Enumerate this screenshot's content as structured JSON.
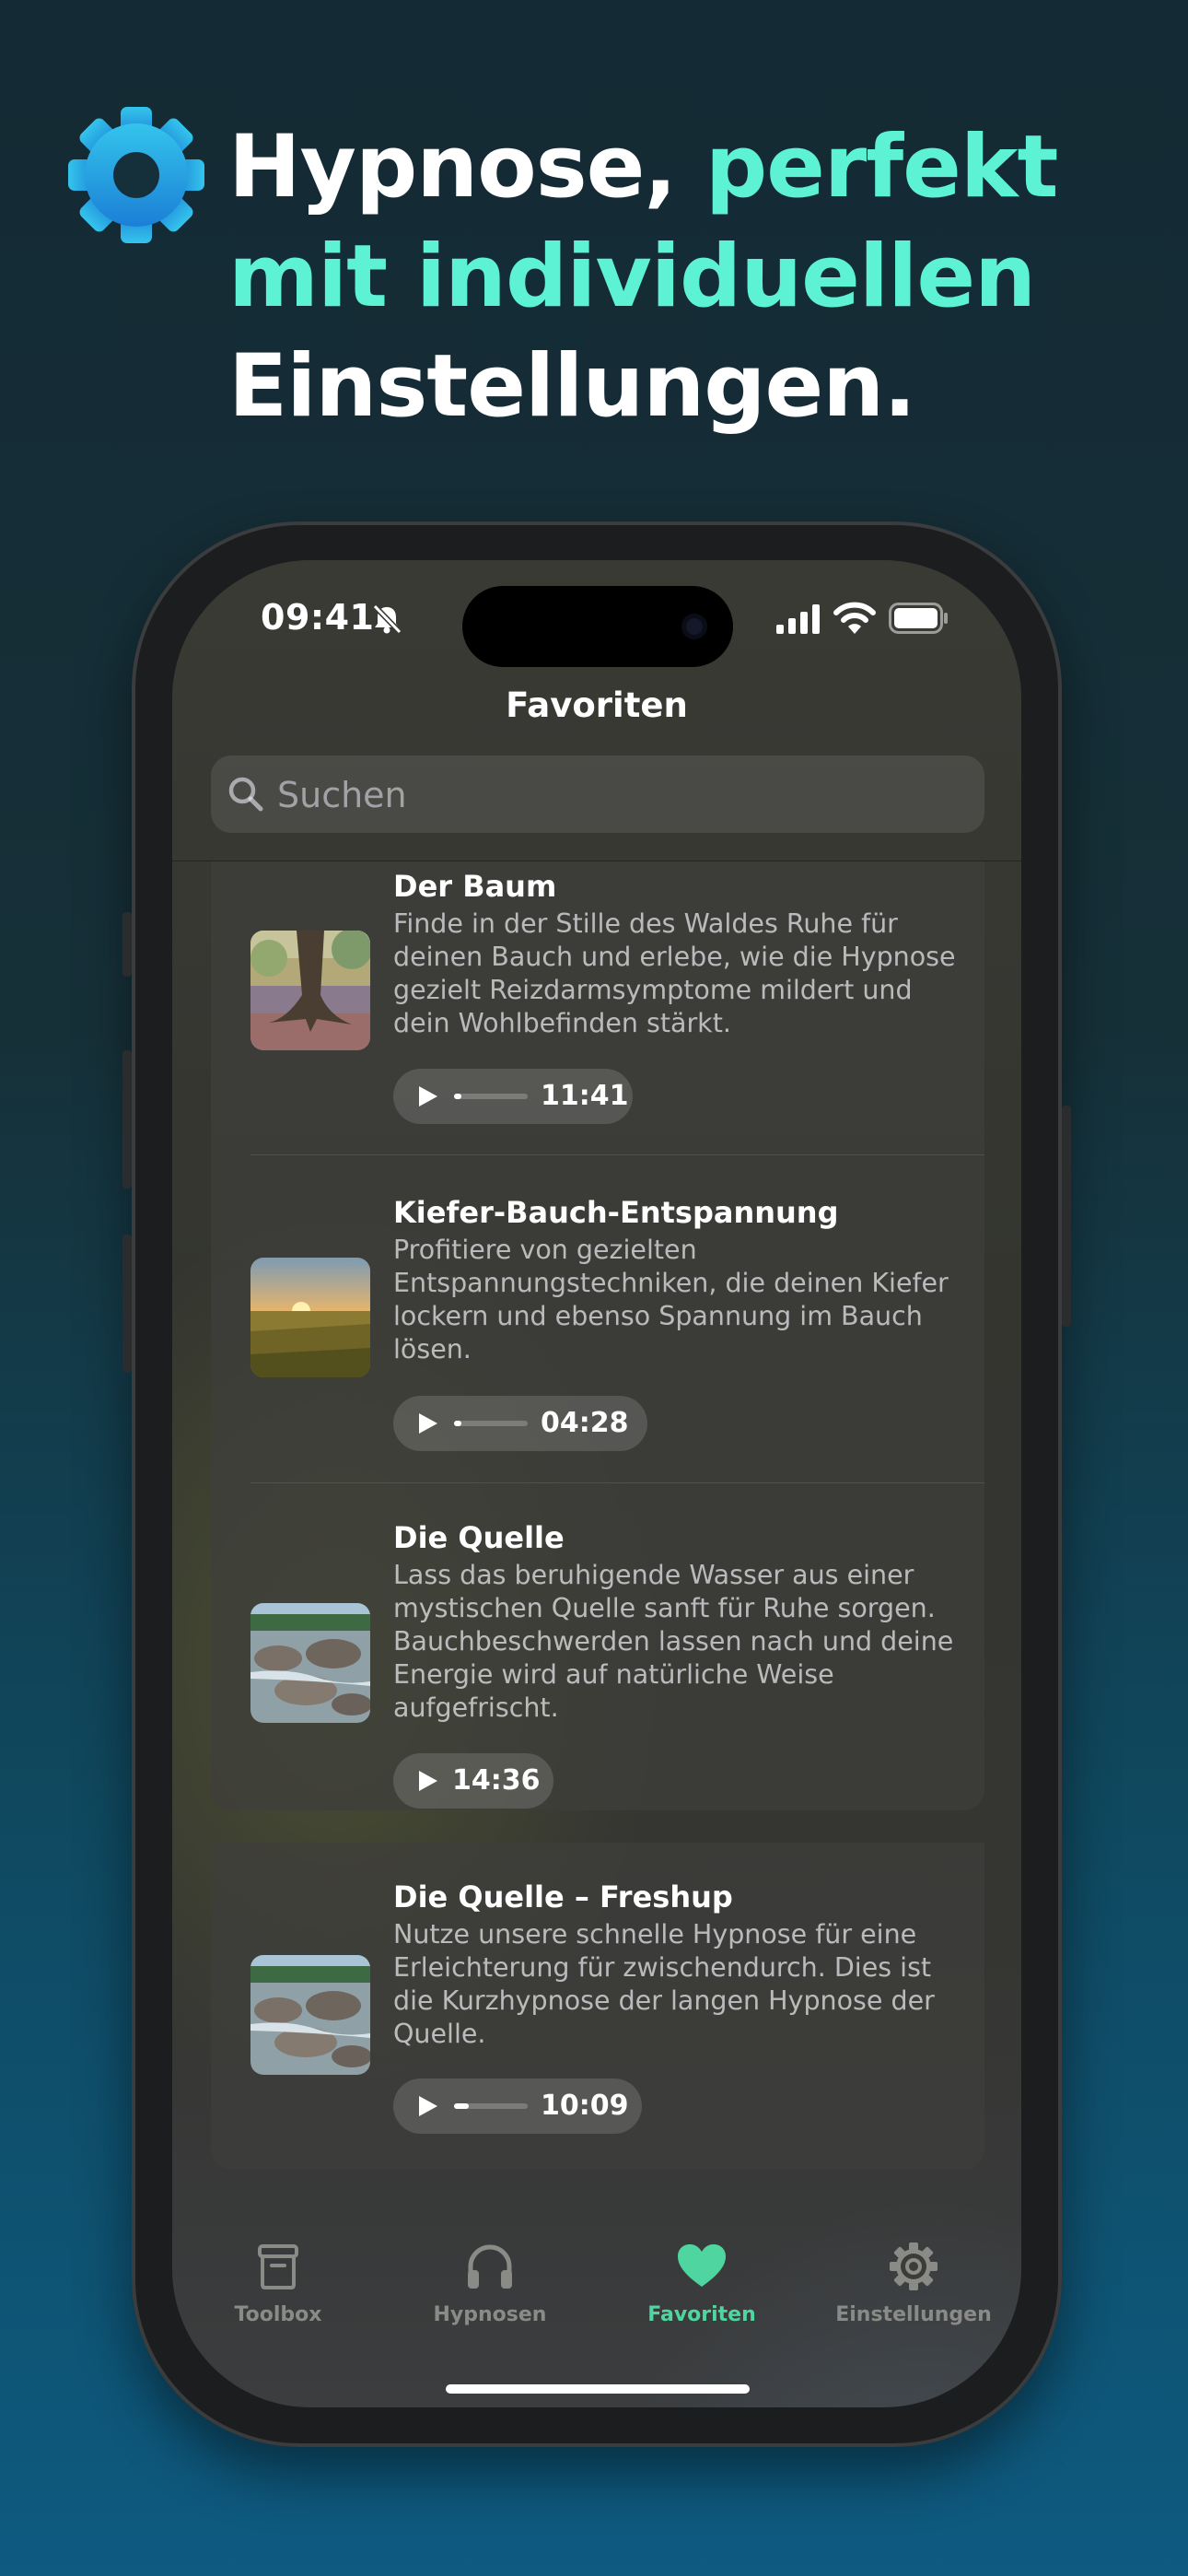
{
  "headline": {
    "line1_white": "Hypnose,",
    "line1_accent": "perfekt",
    "line2_accent": "mit individuellen",
    "line3_white": "Einstellungen.",
    "icon": "gear-icon",
    "accent_color": "#5ef2d4"
  },
  "status_bar": {
    "time": "09:41",
    "icons": [
      "bell-slash-icon",
      "cellular-signal-icon",
      "wifi-icon",
      "battery-icon"
    ]
  },
  "nav": {
    "title": "Favoriten"
  },
  "search": {
    "placeholder": "Suchen",
    "icon": "search-icon"
  },
  "favorites": [
    {
      "title": "Der Baum",
      "description": "Finde in der Stille des Waldes Ruhe für deinen Bauch und erlebe, wie die Hypnose gezielt Reizdarmsymptome mildert und dein Wohlbefinden stärkt.",
      "duration": "11:41",
      "progress": 0.1
    },
    {
      "title": "Kiefer-Bauch-Entspannung",
      "description": "Profitiere von gezielten Entspannungstechniken, die deinen Kiefer lockern und ebenso Spannung im Bauch lösen.",
      "duration": "04:28",
      "progress": 0.1
    },
    {
      "title": "Die Quelle",
      "description": "Lass das beruhigende Wasser aus einer mystischen Quelle sanft für Ruhe sorgen. Bauchbeschwerden lassen nach und deine Energie wird auf natürliche Weise aufgefrischt.",
      "duration": "14:36",
      "progress": null
    },
    {
      "title": "Die Quelle – Freshup",
      "description": "Nutze unsere schnelle Hypnose für eine Erleichterung für zwischendurch. Dies ist die Kurzhypnose der langen Hypnose der Quelle.",
      "duration": "10:09",
      "progress": 0.2
    }
  ],
  "tabs": [
    {
      "label": "Toolbox",
      "icon": "archive-box-icon",
      "active": false
    },
    {
      "label": "Hypnosen",
      "icon": "headphones-icon",
      "active": false
    },
    {
      "label": "Favoriten",
      "icon": "heart-icon",
      "active": true
    },
    {
      "label": "Einstellungen",
      "icon": "gear-icon",
      "active": false
    }
  ],
  "colors": {
    "tab_active": "#4fd6a0",
    "tab_inactive": "#8a8a86"
  }
}
